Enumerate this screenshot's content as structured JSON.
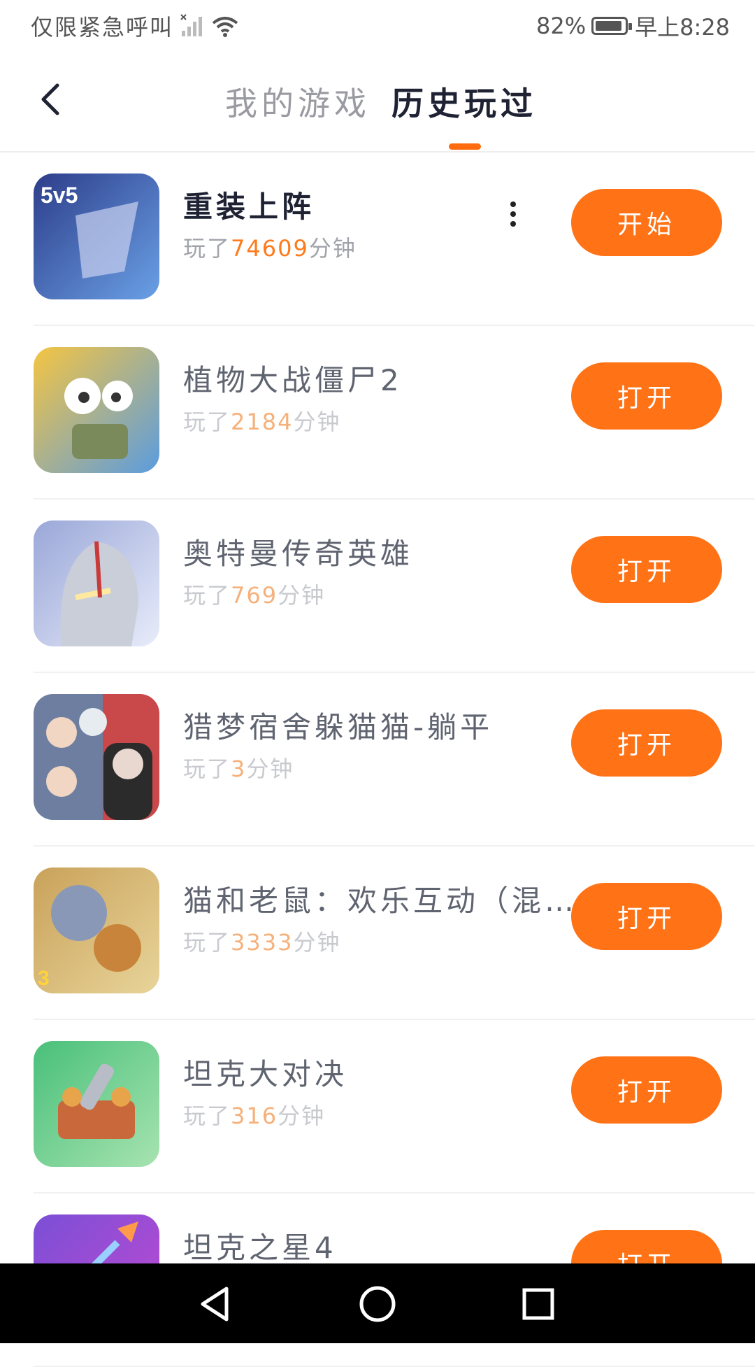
{
  "status_bar": {
    "left_text": "仅限紧急呼叫",
    "battery": "82%",
    "time": "早上8:28"
  },
  "header": {
    "tabs": [
      "我的游戏",
      "历史玩过"
    ],
    "active_tab": "历史玩过"
  },
  "games": [
    {
      "title": "重装上阵",
      "prefix": "玩了",
      "minutes": "74609",
      "suffix": "分钟",
      "button": "开始",
      "colors": [
        "#2d3d8a",
        "#6aa0e6"
      ]
    },
    {
      "title": "植物大战僵尸2",
      "prefix": "玩了",
      "minutes": "2184",
      "suffix": "分钟",
      "button": "打开",
      "colors": [
        "#f5c542",
        "#5b9ce0"
      ]
    },
    {
      "title": "奥特曼传奇英雄",
      "prefix": "玩了",
      "minutes": "769",
      "suffix": "分钟",
      "button": "打开",
      "colors": [
        "#9aa7d8",
        "#d9dff5"
      ]
    },
    {
      "title": "猎梦宿舍躲猫猫-躺平",
      "prefix": "玩了",
      "minutes": "3",
      "suffix": "分钟",
      "button": "打开",
      "colors": [
        "#5a6b8a",
        "#c9484a"
      ]
    },
    {
      "title": "猫和老鼠：欢乐互动（混…",
      "prefix": "玩了",
      "minutes": "3333",
      "suffix": "分钟",
      "button": "打开",
      "colors": [
        "#c9a25a",
        "#e8d49a"
      ]
    },
    {
      "title": "坦克大对决",
      "prefix": "玩了",
      "minutes": "316",
      "suffix": "分钟",
      "button": "打开",
      "colors": [
        "#49c07a",
        "#c97a3a"
      ]
    },
    {
      "title": "坦克之星4",
      "prefix": "",
      "minutes": "",
      "suffix": "",
      "button": "打开",
      "colors": [
        "#7b4fd6",
        "#c04ad1"
      ]
    }
  ]
}
